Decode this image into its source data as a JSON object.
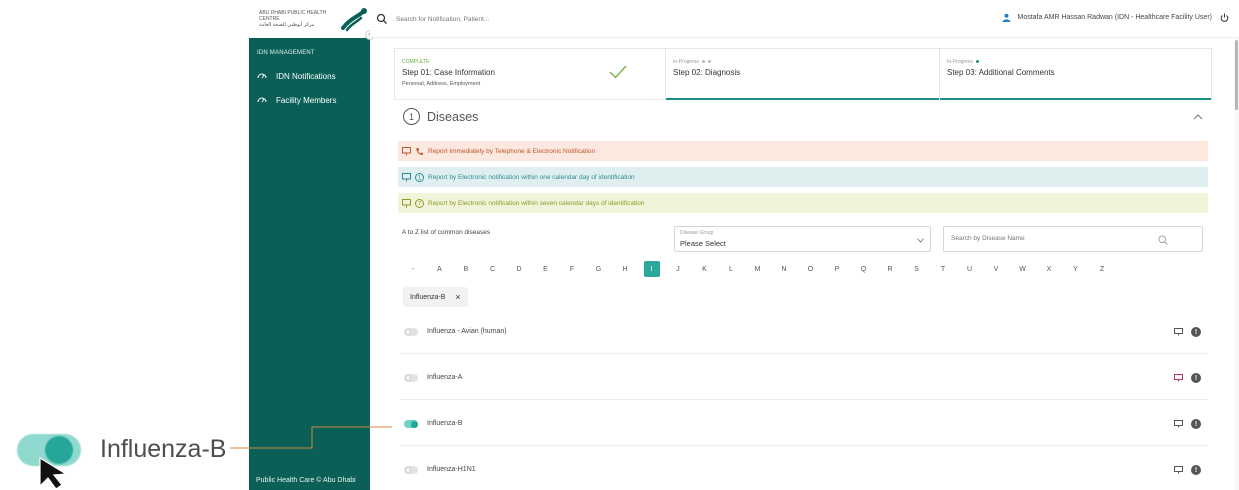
{
  "brand": {
    "text_en": "ABU DHABI PUBLIC HEALTH CENTRE",
    "text_ar": "مركز أبوظبي للصحة العامة",
    "collapse_glyph": "«",
    "logo_icon": "adphc-logo-icon"
  },
  "sidebar": {
    "section_title": "IDN MANAGEMENT",
    "items": [
      {
        "label": "IDN Notifications",
        "icon": "gauge-icon"
      },
      {
        "label": "Facility Members",
        "icon": "gauge-icon"
      }
    ],
    "footer": "Public Health Care © Abu Dhabi",
    "color": "#0a6056"
  },
  "topbar": {
    "search_placeholder": "Search for Notification, Patient...",
    "user_label": "Mostafa AMR Hassan Radwan (IDN - Healthcare Facility User)"
  },
  "stepper": {
    "steps": [
      {
        "status": "COMPLETE",
        "title": "Step 01: Case Information",
        "sub": "Personal, Address, Employment"
      },
      {
        "status": "In-Progress",
        "title": "Step 02: Diagnosis",
        "sub": ""
      },
      {
        "status": "In-Progress",
        "title": "Step 03: Additional Comments",
        "sub": ""
      }
    ]
  },
  "diseases_section": {
    "number": "1",
    "title": "Diseases",
    "notices": [
      {
        "text": "Report Immediately by Telephone & Electronic Notification",
        "color": "#c0562e"
      },
      {
        "text": "Report by Electronic notification within one calendar day of identification",
        "badge": "1",
        "color": "#2f8b93"
      },
      {
        "text": "Report by Electronic notification within seven calendar days of identification",
        "badge": "7",
        "color": "#8c9b2a"
      }
    ],
    "az_label": "A to Z list of common diseases",
    "disease_group": {
      "caption": "Disease Group",
      "value": "Please Select"
    },
    "search_placeholder": "Search by Disease Name",
    "letters": [
      "-",
      "A",
      "B",
      "C",
      "D",
      "E",
      "F",
      "G",
      "H",
      "I",
      "J",
      "K",
      "L",
      "M",
      "N",
      "O",
      "P",
      "Q",
      "R",
      "S",
      "T",
      "U",
      "V",
      "W",
      "X",
      "Y",
      "Z"
    ],
    "active_letter": "I",
    "selected_chip": "Influenza-B",
    "chip_close": "×",
    "list": [
      {
        "name": "Influenza - Avian (human)",
        "on": false,
        "monitor_color": "#555555",
        "info": "!"
      },
      {
        "name": "Influenza-A",
        "on": false,
        "monitor_color": "#c0306a",
        "info": "!"
      },
      {
        "name": "Influenza-B",
        "on": true,
        "monitor_color": "#555555",
        "info": "!"
      },
      {
        "name": "Influenza-H1N1",
        "on": false,
        "monitor_color": "#555555",
        "info": "!"
      }
    ]
  },
  "zoom_callout": {
    "label": "Influenza-B"
  },
  "colors": {
    "accent": "#1a8f83",
    "complete_green": "#6aaa3a",
    "connector": "#d4863f"
  }
}
